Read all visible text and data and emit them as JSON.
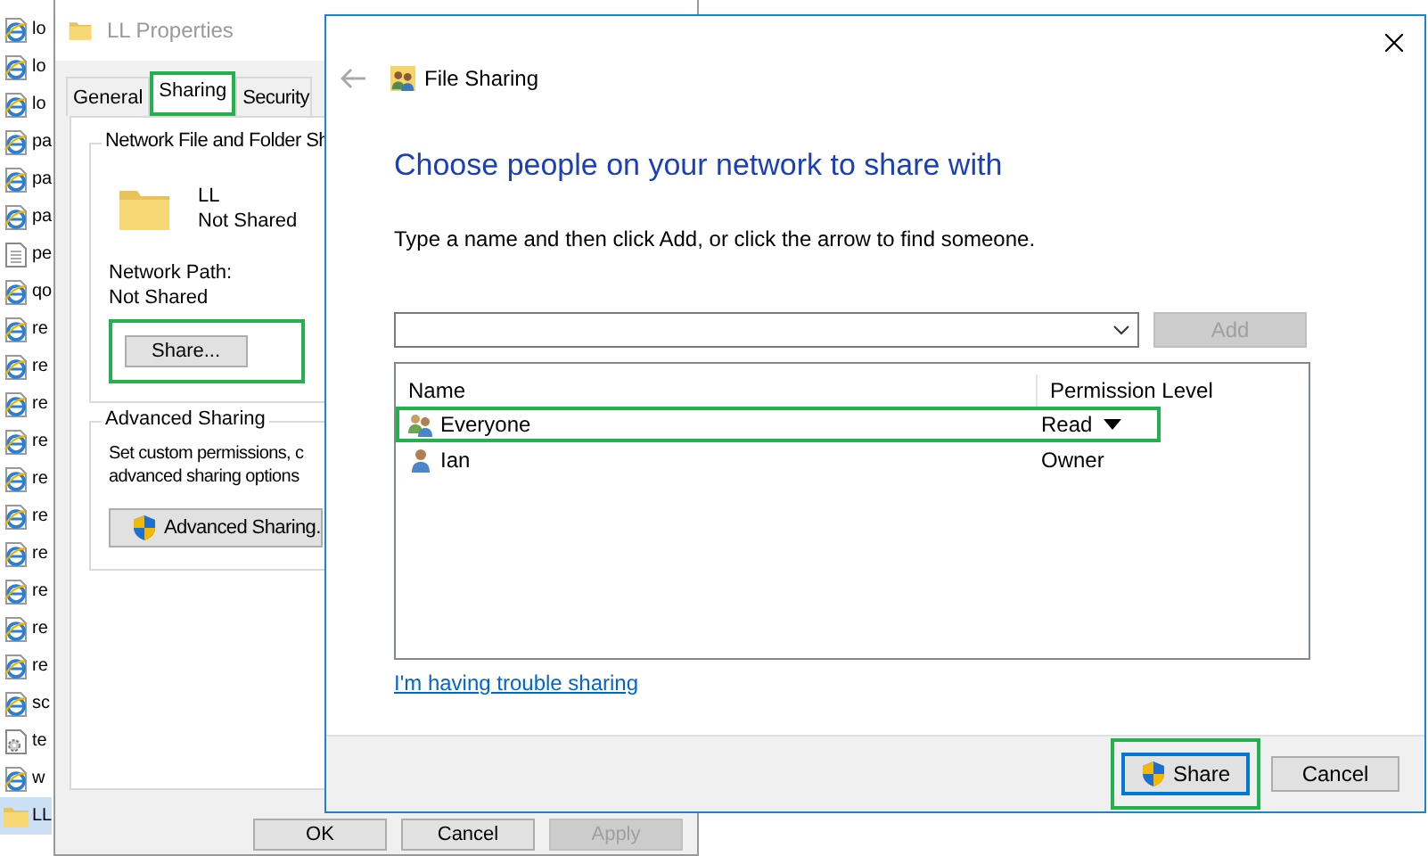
{
  "file_list": [
    {
      "name": "lo",
      "kind": "web",
      "selected": false
    },
    {
      "name": "lo",
      "kind": "web",
      "selected": false
    },
    {
      "name": "lo",
      "kind": "web",
      "selected": false
    },
    {
      "name": "pa",
      "kind": "web",
      "selected": false
    },
    {
      "name": "pa",
      "kind": "web",
      "selected": false
    },
    {
      "name": "pa",
      "kind": "web",
      "selected": false
    },
    {
      "name": "pe",
      "kind": "text",
      "selected": false
    },
    {
      "name": "qo",
      "kind": "web",
      "selected": false
    },
    {
      "name": "re",
      "kind": "web",
      "selected": false
    },
    {
      "name": "re",
      "kind": "web",
      "selected": false
    },
    {
      "name": "re",
      "kind": "web",
      "selected": false
    },
    {
      "name": "re",
      "kind": "web",
      "selected": false
    },
    {
      "name": "re",
      "kind": "web",
      "selected": false
    },
    {
      "name": "re",
      "kind": "web",
      "selected": false
    },
    {
      "name": "re",
      "kind": "web",
      "selected": false
    },
    {
      "name": "re",
      "kind": "web",
      "selected": false
    },
    {
      "name": "re",
      "kind": "web",
      "selected": false
    },
    {
      "name": "re",
      "kind": "web",
      "selected": false
    },
    {
      "name": "sc",
      "kind": "web",
      "selected": false
    },
    {
      "name": "te",
      "kind": "settings",
      "selected": false
    },
    {
      "name": "w",
      "kind": "web",
      "selected": false
    },
    {
      "name": "LL",
      "kind": "folder",
      "selected": true
    }
  ],
  "properties": {
    "title": "LL Properties",
    "tabs": [
      {
        "label": "General",
        "selected": false,
        "highlighted": false
      },
      {
        "label": "Sharing",
        "selected": true,
        "highlighted": true
      },
      {
        "label": "Security",
        "selected": false,
        "highlighted": false
      }
    ],
    "group_title": "Network File and Folder Sh",
    "folder_name": "LL",
    "folder_status": "Not Shared",
    "path_label": "Network Path:",
    "path_value": "Not Shared",
    "share_button": {
      "label": "Share...",
      "highlighted": true
    },
    "advanced_title": "Advanced Sharing",
    "advanced_lines": [
      "Set custom permissions, c",
      "advanced sharing options"
    ],
    "advanced_button": "Advanced Sharing.",
    "buttons": [
      {
        "label": "OK",
        "disabled": false
      },
      {
        "label": "Cancel",
        "disabled": false
      },
      {
        "label": "Apply",
        "disabled": true
      }
    ]
  },
  "dialog": {
    "title": "File Sharing",
    "heading": "Choose people on your network to share with",
    "instruction": "Type a name and then click Add, or click the arrow to find someone.",
    "add_button": {
      "label": "Add",
      "disabled": true
    },
    "columns": [
      "Name",
      "Permission Level"
    ],
    "rows": [
      {
        "name": "Everyone",
        "kind": "group",
        "permission": "Read",
        "dropdown": true,
        "highlighted": true
      },
      {
        "name": "Ian",
        "kind": "user",
        "permission": "Owner",
        "dropdown": false,
        "highlighted": false
      }
    ],
    "help_link": "I'm having trouble sharing",
    "buttons": [
      {
        "label": "Share",
        "primary": true,
        "highlighted": true
      },
      {
        "label": "Cancel",
        "primary": false,
        "highlighted": false
      }
    ]
  }
}
